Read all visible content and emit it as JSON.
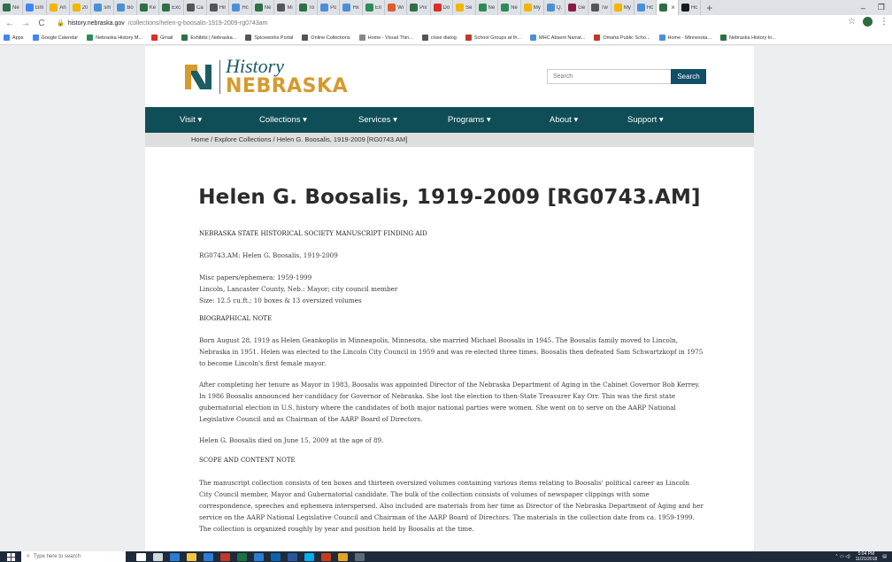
{
  "browser": {
    "tabs": [
      {
        "label": "Ne",
        "color": "#2f6f44"
      },
      {
        "label": "Gm",
        "color": "#4285f4"
      },
      {
        "label": "An",
        "color": "#f4b400"
      },
      {
        "label": "20",
        "color": "#f4b400"
      },
      {
        "label": "sm",
        "color": "#4a90d9"
      },
      {
        "label": "Bo",
        "color": "#4a90d9"
      },
      {
        "label": "Ke",
        "color": "#2f6f44"
      },
      {
        "label": "Exc",
        "color": "#2f6f44"
      },
      {
        "label": "Ca",
        "color": "#555555"
      },
      {
        "label": "Hir",
        "color": "#555555"
      },
      {
        "label": "Hc",
        "color": "#4a90d9"
      },
      {
        "label": "Ne",
        "color": "#2f6f44"
      },
      {
        "label": "Mi",
        "color": "#555555"
      },
      {
        "label": "To",
        "color": "#2f6f44"
      },
      {
        "label": "Po",
        "color": "#4a90d9"
      },
      {
        "label": "Hx",
        "color": "#4a90d9"
      },
      {
        "label": "En",
        "color": "#2e8b57"
      },
      {
        "label": "Wi",
        "color": "#e05a2b"
      },
      {
        "label": "Pix",
        "color": "#2f6f44"
      },
      {
        "label": "Do",
        "color": "#d93025"
      },
      {
        "label": "Se",
        "color": "#f4b400"
      },
      {
        "label": "Ne",
        "color": "#2e8b57"
      },
      {
        "label": "Ne",
        "color": "#2e8b57"
      },
      {
        "label": "My",
        "color": "#f4b400"
      },
      {
        "label": "Q.",
        "color": "#4a90d9"
      },
      {
        "label": "Ge",
        "color": "#8b1a4a"
      },
      {
        "label": "Tw",
        "color": "#555555"
      },
      {
        "label": "My",
        "color": "#f4b400"
      },
      {
        "label": "Hc",
        "color": "#4a90d9"
      }
    ],
    "active_tab": {
      "label": "",
      "color": "#2f6f44"
    },
    "extra_tab": {
      "label": "Hc",
      "color": "#1a1a1a"
    },
    "window_controls": {
      "minimize": "–",
      "restore": "❐"
    },
    "url_host": "history.nebraska.gov",
    "url_path": "/collections/helen-g-boosalis-1919-2009-rg0743am",
    "bookmarks": [
      {
        "label": "Apps",
        "color": "#4285f4"
      },
      {
        "label": "Google Calendar",
        "color": "#4285f4"
      },
      {
        "label": "Nebraska History M...",
        "color": "#2e8b57"
      },
      {
        "label": "Gmail",
        "color": "#d93025"
      },
      {
        "label": "Exhibits | Nebraska...",
        "color": "#2f6f44"
      },
      {
        "label": "Spiceworks Portal",
        "color": "#555555"
      },
      {
        "label": "Online Collections",
        "color": "#555555"
      },
      {
        "label": "Home - Visual Thin...",
        "color": "#888888"
      },
      {
        "label": "close dialog",
        "color": "#555555"
      },
      {
        "label": "School Groups at th...",
        "color": "#c0392b"
      },
      {
        "label": "MHC Absent Narrat...",
        "color": "#4a90d9"
      },
      {
        "label": "Omaha Public Scho...",
        "color": "#c0392b"
      },
      {
        "label": "Home - Minnesota...",
        "color": "#4a90d9"
      },
      {
        "label": "Nebraska History In...",
        "color": "#2f6f44"
      }
    ]
  },
  "site": {
    "logo_line1": "History",
    "logo_line2": "NEBRASKA",
    "search_placeholder": "Search",
    "search_button": "Search",
    "nav": [
      "Visit ▾",
      "Collections ▾",
      "Services ▾",
      "Programs ▾",
      "About ▾",
      "Support ▾"
    ],
    "breadcrumb": "Home / Explore Collections / Helen G. Boosalis, 1919-2009 [RG0743.AM]"
  },
  "document": {
    "title": "Helen G. Boosalis, 1919-2009 [RG0743.AM]",
    "heading_finding_aid": "NEBRASKA STATE HISTORICAL SOCIETY MANUSCRIPT FINDING AID",
    "collection_id": "RG0743.AM:  Helen G. Boosalis, 1919-2009",
    "misc_line1": "Misc papers/ephemera:  1959-1999",
    "misc_line2": "Lincoln, Lancaster County, Neb.:  Mayor; city council member",
    "misc_line3": "Size:  12.5 cu.ft.; 10 boxes & 13 oversized volumes",
    "heading_bio": "BIOGRAPHICAL NOTE",
    "bio_p1": "Born August 28, 1919 as Helen Geankoplis in Minneapolis, Minnesota, she married Michael Boosalis in 1945. The Boosalis family moved to Lincoln, Nebraska in 1951. Helen was elected to the Lincoln City Council in 1959 and was re-elected three times. Boosalis then defeated Sam Schwartzkopf in 1975 to become Lincoln's first female mayor.",
    "bio_p2": "After completing her tenure as Mayor in 1983, Boosalis was appointed Director of the Nebraska Department of Aging in the Cabinet Governor Bob Kerrey. In 1986 Boosalis announced her candidacy for Governor of Nebraska. She lost the election to then-State Treasurer Kay Orr. This was the first state gubernatorial election in U.S. history where the candidates of both major national parties were women. She went on to serve on the AARP National Legislative Council and as Chairman of the AARP Board of Directors.",
    "bio_p3": "Helen G. Boosalis died on June 15, 2009 at the age of 89.",
    "heading_scope": "SCOPE AND CONTENT NOTE",
    "scope_p1": "The manuscript collection consists of ten boxes and thirteen oversized volumes containing various items relating to Boosalis' political career as Lincoln City Council member, Mayor and Gubernatorial candidate. The bulk of the collection consists of volumes of newspaper clippings with some correspondence, speeches and ephemera interspersed. Also included are materials from her time as Director of the Nebraska Department of Aging and her service on the AARP National Legislative Council and Chairman of the AARP Board of Directors. The materials in the collection date from ca. 1959-1999. The collection is organized roughly by year and position held by Boosalis at the time."
  },
  "taskbar": {
    "search_placeholder": "Type here to search",
    "time": "5:04 PM",
    "date": "11/21/2018",
    "apps": [
      {
        "name": "cortana",
        "color": "#ffffff"
      },
      {
        "name": "task-view",
        "color": "#cfd8dc"
      },
      {
        "name": "ie",
        "color": "#2b7cd3"
      },
      {
        "name": "file-explorer",
        "color": "#f4c542"
      },
      {
        "name": "store",
        "color": "#2b7cd3"
      },
      {
        "name": "access",
        "color": "#c0392b"
      },
      {
        "name": "excel",
        "color": "#1e7145"
      },
      {
        "name": "edge",
        "color": "#2b7cd3"
      },
      {
        "name": "outlook",
        "color": "#0a64ad"
      },
      {
        "name": "word",
        "color": "#2b579a"
      },
      {
        "name": "skype",
        "color": "#00aff0"
      },
      {
        "name": "powerpoint",
        "color": "#c43e1c"
      },
      {
        "name": "chrome",
        "color": "#e0a526"
      },
      {
        "name": "photos",
        "color": "#5a6b7a"
      }
    ]
  }
}
